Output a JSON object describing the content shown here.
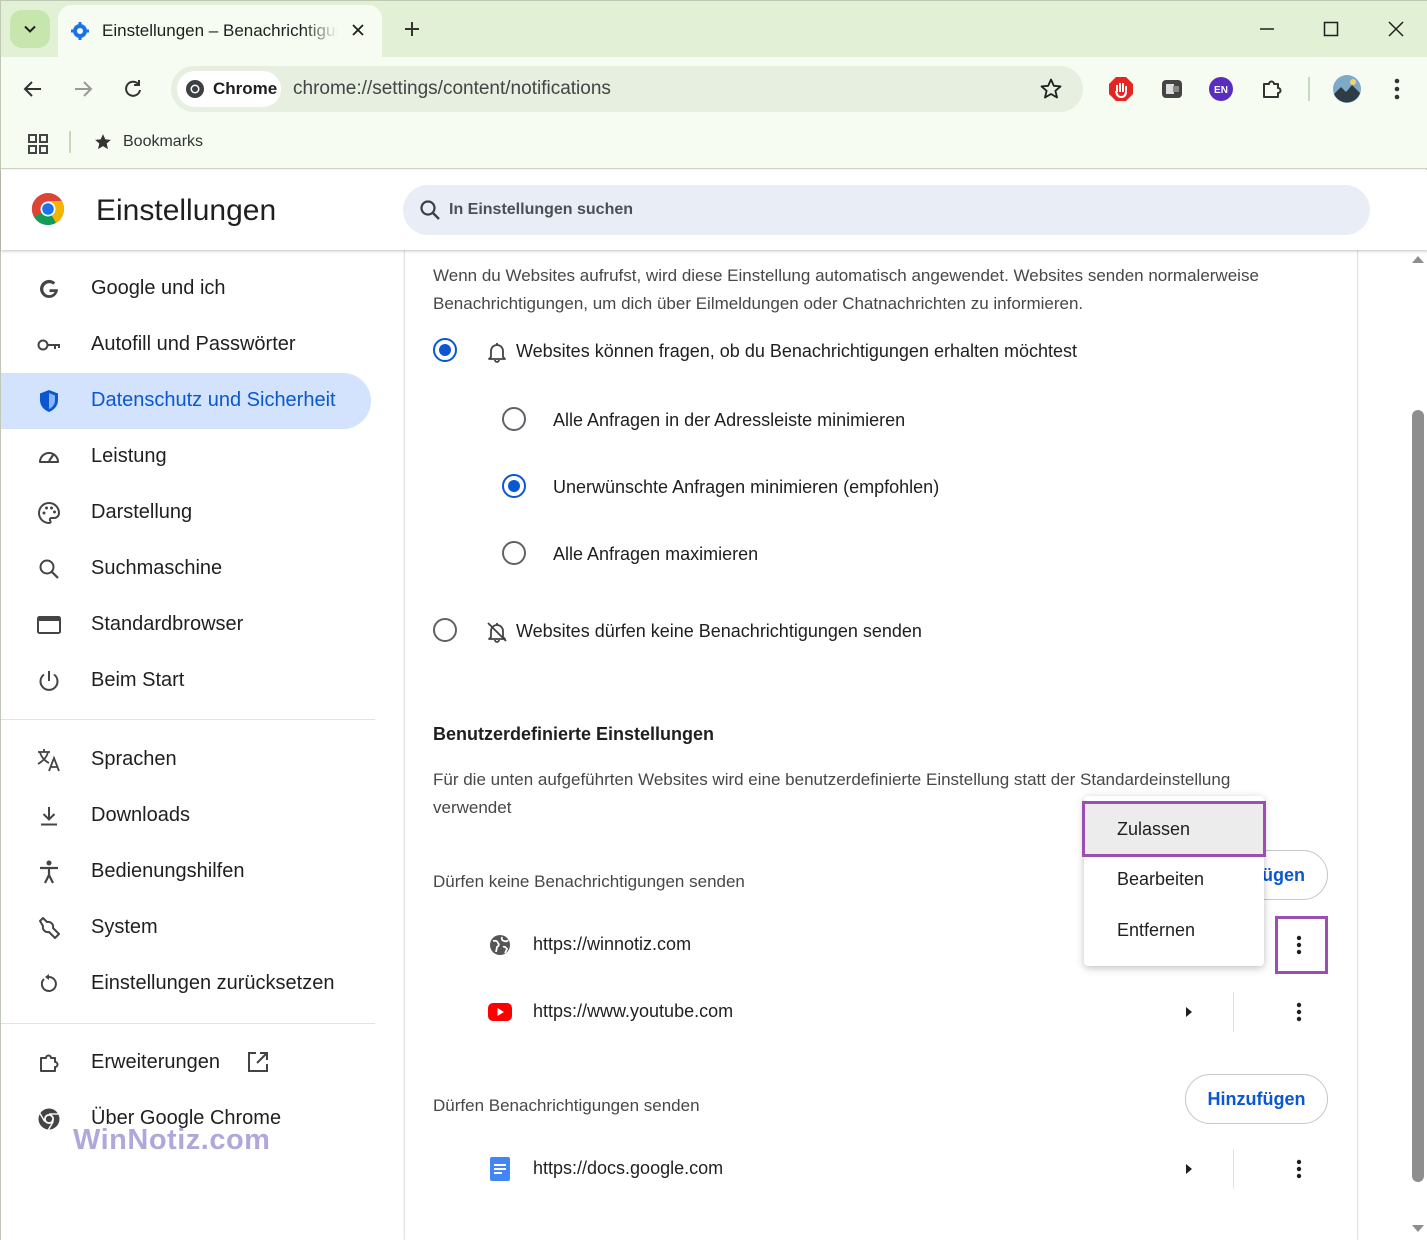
{
  "browser": {
    "tab_title": "Einstellungen – Benachrichtigungen",
    "url_chip_label": "Chrome",
    "url": "chrome://settings/content/notifications",
    "extension_badge": "EN",
    "bookmarks_label": "Bookmarks"
  },
  "settings": {
    "title": "Einstellungen",
    "search_placeholder": "In Einstellungen suchen"
  },
  "sidebar": {
    "items": [
      {
        "label": "Google und ich",
        "icon": "google-icon"
      },
      {
        "label": "Autofill und Passwörter",
        "icon": "key-icon"
      },
      {
        "label": "Datenschutz und Sicherheit",
        "icon": "shield-icon",
        "active": true
      },
      {
        "label": "Leistung",
        "icon": "gauge-icon"
      },
      {
        "label": "Darstellung",
        "icon": "palette-icon"
      },
      {
        "label": "Suchmaschine",
        "icon": "search-icon"
      },
      {
        "label": "Standardbrowser",
        "icon": "browser-window-icon"
      },
      {
        "label": "Beim Start",
        "icon": "power-icon"
      },
      {
        "label": "Sprachen",
        "icon": "translate-icon"
      },
      {
        "label": "Downloads",
        "icon": "download-icon"
      },
      {
        "label": "Bedienungshilfen",
        "icon": "accessibility-icon"
      },
      {
        "label": "System",
        "icon": "wrench-icon"
      },
      {
        "label": "Einstellungen zurücksetzen",
        "icon": "reset-icon"
      },
      {
        "label": "Erweiterungen",
        "icon": "puzzle-icon"
      },
      {
        "label": "Über Google Chrome",
        "icon": "chrome-icon"
      }
    ]
  },
  "watermark": "WinNotiz.com",
  "content": {
    "intro": "Wenn du Websites aufrufst, wird diese Einstellung automatisch angewendet. Websites senden normalerweise Benachrichtigungen, um dich über Eilmeldungen oder Chatnachrichten zu informieren.",
    "option_ask": "Websites können fragen, ob du Benachrichtigungen erhalten möchtest",
    "sub_option_quiet_all": "Alle Anfragen in der Adressleiste minimieren",
    "sub_option_quiet_unwanted": "Unerwünschte Anfragen minimieren (empfohlen)",
    "sub_option_expand_all": "Alle Anfragen maximieren",
    "option_block": "Websites dürfen keine Benachrichtigungen senden",
    "custom_title": "Benutzerdefinierte Einstellungen",
    "custom_desc": "Für die unten aufgeführten Websites wird eine benutzerdefinierte Einstellung statt der Standardeinstellung verwendet",
    "blocked_heading": "Dürfen keine Benachrichtigungen senden",
    "blocked_add_visible": "ügen",
    "blocked_sites": [
      "https://winnotiz.com",
      "https://www.youtube.com"
    ],
    "allowed_heading": "Dürfen Benachrichtigungen senden",
    "allowed_add": "Hinzufügen",
    "allowed_sites": [
      "https://docs.google.com"
    ]
  },
  "context_menu": {
    "items": [
      "Zulassen",
      "Bearbeiten",
      "Entfernen"
    ]
  },
  "colors": {
    "accent": "#0b57d0",
    "active_nav_bg": "#d3e3fd",
    "highlight_box": "#9b4fb3",
    "tabstrip_bg": "#e2f1d6"
  }
}
